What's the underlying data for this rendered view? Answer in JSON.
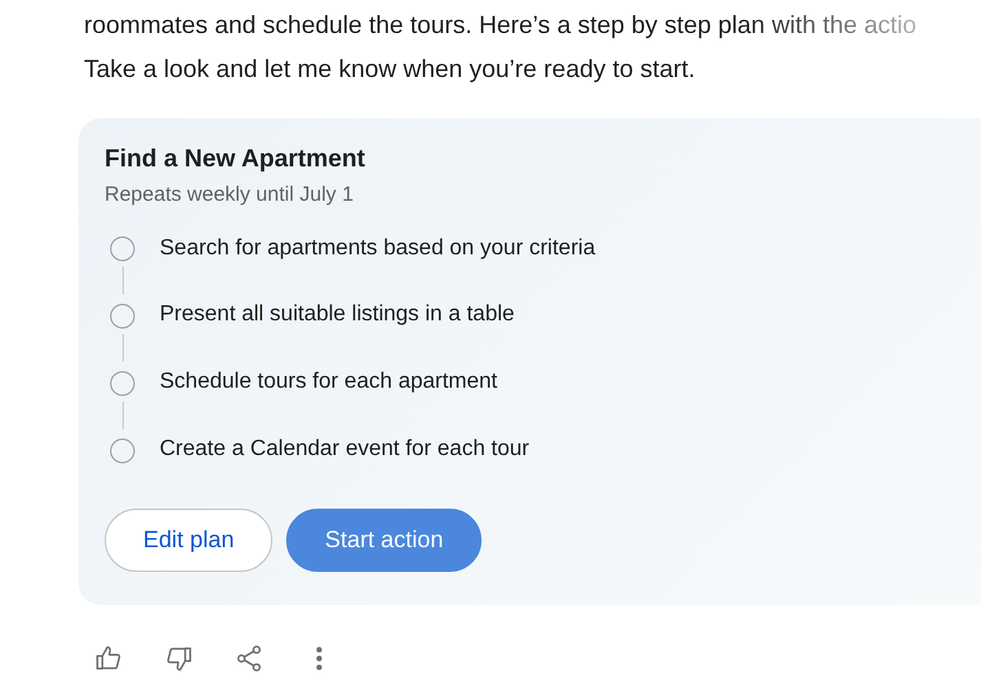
{
  "message": {
    "lines": [
      "roommates and schedule the tours. Here’s a step by step plan with the actio",
      "Take a look and let me know when you’re ready to start."
    ]
  },
  "plan": {
    "title": "Find a New Apartment",
    "subtitle": "Repeats weekly until July 1",
    "steps": [
      {
        "label": "Search for apartments based on your criteria"
      },
      {
        "label": "Present all suitable listings in a table"
      },
      {
        "label": "Schedule tours for each apartment"
      },
      {
        "label": "Create a Calendar event for each tour"
      }
    ],
    "buttons": [
      {
        "label": "Edit plan",
        "kind": "outline"
      },
      {
        "label": "Start action",
        "kind": "filled"
      }
    ]
  },
  "actions": [
    {
      "kind": "thumbs-up"
    },
    {
      "kind": "thumbs-down"
    },
    {
      "kind": "share"
    },
    {
      "kind": "more"
    }
  ]
}
